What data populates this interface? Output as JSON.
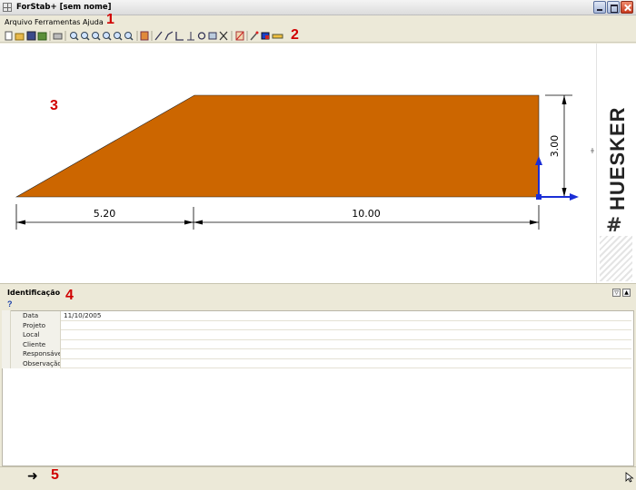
{
  "window": {
    "title": "ForStab+ [sem nome]"
  },
  "menu": {
    "items": [
      "Arquivo",
      "Ferramentas",
      "Ajuda"
    ]
  },
  "callouts": [
    "1",
    "2",
    "3",
    "4",
    "5"
  ],
  "toolbar": {
    "icons": [
      "new-file-icon",
      "open-file-icon",
      "save-icon",
      "export-icon",
      "print-icon",
      "zoom-in-icon",
      "zoom-in-plus-icon",
      "zoom-window-icon",
      "zoom-extents-icon",
      "zoom-previous-icon",
      "zoom-out-icon",
      "pan-icon",
      "line-icon",
      "polyline-icon",
      "angle-icon",
      "perpendicular-icon",
      "circle-icon",
      "layers-icon",
      "delete-icon",
      "anchor-icon",
      "paint-icon",
      "material-icon",
      "ruler-icon"
    ]
  },
  "drawing": {
    "colors": {
      "slope_fill": "#cc6600",
      "axis": "#1a2ed6",
      "dimension": "#000000"
    },
    "dim_base_left": "5.20",
    "dim_base_right": "10.00",
    "dim_height": "3.00"
  },
  "logo": {
    "text": "HUESKER",
    "hash": "#"
  },
  "identification": {
    "title": "Identificação",
    "fields": [
      {
        "key": "Data",
        "value": "11/10/2005"
      },
      {
        "key": "Projeto",
        "value": ""
      },
      {
        "key": "Local",
        "value": ""
      },
      {
        "key": "Cliente",
        "value": ""
      },
      {
        "key": "Responsável",
        "value": ""
      },
      {
        "key": "Observação",
        "value": ""
      }
    ]
  },
  "status": {
    "arrow": "➜"
  }
}
